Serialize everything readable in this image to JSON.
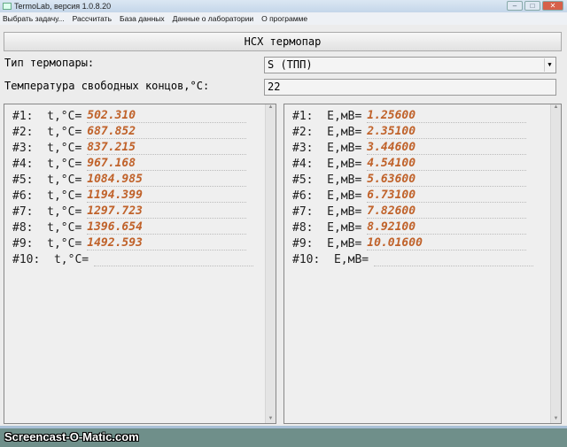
{
  "window": {
    "title": "TermoLab, версия 1.0.8.20"
  },
  "menu": [
    "Выбрать задачу...",
    "Рассчитать",
    "База данных",
    "Данные о лаборатории",
    "О программе"
  ],
  "header": "НСХ термопар",
  "thermocouple": {
    "label": "Тип термопары:",
    "value": "S (ТПП)"
  },
  "cold_junction": {
    "label": "Температура свободных концов,°C:",
    "value": "22"
  },
  "left_panel": {
    "rows": [
      {
        "n": "#1:",
        "q": "  t,°C=",
        "v": "502.310"
      },
      {
        "n": "#2:",
        "q": "  t,°C=",
        "v": "687.852"
      },
      {
        "n": "#3:",
        "q": "  t,°C=",
        "v": "837.215"
      },
      {
        "n": "#4:",
        "q": "  t,°C=",
        "v": "967.168"
      },
      {
        "n": "#5:",
        "q": "  t,°C=",
        "v": "1084.985"
      },
      {
        "n": "#6:",
        "q": "  t,°C=",
        "v": "1194.399"
      },
      {
        "n": "#7:",
        "q": "  t,°C=",
        "v": "1297.723"
      },
      {
        "n": "#8:",
        "q": "  t,°C=",
        "v": "1396.654"
      },
      {
        "n": "#9:",
        "q": "  t,°C=",
        "v": "1492.593"
      },
      {
        "n": "#10:",
        "q": "  t,°C=",
        "v": ""
      }
    ]
  },
  "right_panel": {
    "rows": [
      {
        "n": "#1:",
        "q": "  E,мВ=",
        "v": "1.25600"
      },
      {
        "n": "#2:",
        "q": "  E,мВ=",
        "v": "2.35100"
      },
      {
        "n": "#3:",
        "q": "  E,мВ=",
        "v": "3.44600"
      },
      {
        "n": "#4:",
        "q": "  E,мВ=",
        "v": "4.54100"
      },
      {
        "n": "#5:",
        "q": "  E,мВ=",
        "v": "5.63600"
      },
      {
        "n": "#6:",
        "q": "  E,мВ=",
        "v": "6.73100"
      },
      {
        "n": "#7:",
        "q": "  E,мВ=",
        "v": "7.82600"
      },
      {
        "n": "#8:",
        "q": "  E,мВ=",
        "v": "8.92100"
      },
      {
        "n": "#9:",
        "q": "  E,мВ=",
        "v": "10.01600"
      },
      {
        "n": "#10:",
        "q": "  E,мВ=",
        "v": ""
      }
    ]
  },
  "watermark": "Screencast-O-Matic.com"
}
